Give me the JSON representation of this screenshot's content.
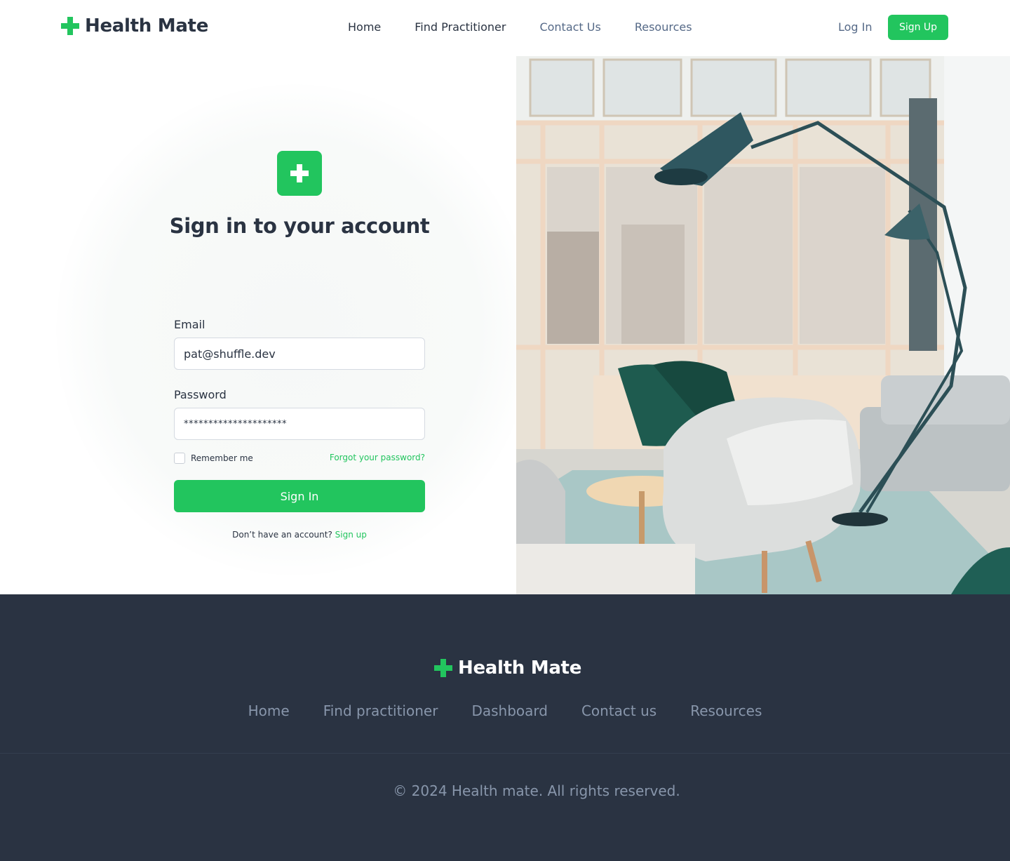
{
  "header": {
    "brand": "Health Mate",
    "nav": [
      {
        "label": "Home"
      },
      {
        "label": "Find Practitioner"
      },
      {
        "label": "Contact Us"
      },
      {
        "label": "Resources"
      }
    ],
    "login_label": "Log In",
    "signup_label": "Sign Up"
  },
  "signin": {
    "title": "Sign in to your account",
    "email_label": "Email",
    "email_value": "pat@shuffle.dev",
    "password_label": "Password",
    "password_value": "*********************",
    "remember_label": "Remember me",
    "forgot_label": "Forgot your password?",
    "submit_label": "Sign In",
    "no_account_text": "Don’t have an account?",
    "signup_link": "Sign up"
  },
  "footer": {
    "brand": "Health Mate",
    "nav": [
      {
        "label": "Home"
      },
      {
        "label": "Find practitioner"
      },
      {
        "label": "Dashboard"
      },
      {
        "label": "Contact us"
      },
      {
        "label": "Resources"
      }
    ],
    "copyright": "© 2024 Health mate. All rights reserved."
  },
  "colors": {
    "accent": "#22c55e",
    "heading": "#2a3342",
    "muted": "#556987",
    "footer_bg": "#2a3342",
    "footer_text": "#8896ab"
  },
  "icons": {
    "brand_logo": "plus-cross-icon",
    "form_logo": "plus-cross-icon"
  }
}
